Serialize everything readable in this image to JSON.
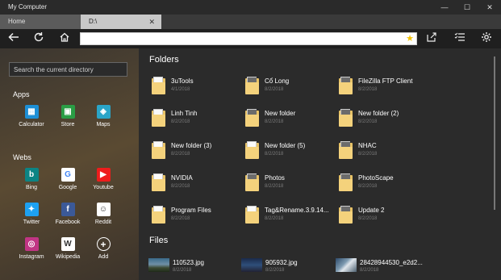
{
  "window": {
    "title": "My Computer",
    "minimize": "—",
    "maximize": "☐",
    "close": "✕"
  },
  "tabs": [
    {
      "label": "Home"
    },
    {
      "label": "D:\\",
      "close": "✕"
    }
  ],
  "toolbar": {
    "address_value": "",
    "icons": [
      "back-arrow-icon",
      "refresh-icon",
      "home-icon",
      "star-icon",
      "share-icon",
      "selection-icon",
      "gear-icon"
    ]
  },
  "sidebar": {
    "search_placeholder": "Search the current directory",
    "apps_heading": "Apps",
    "apps": [
      {
        "label": "Calculator",
        "icon": "calculator-icon",
        "color": "#1d8fd6",
        "glyph": "▦"
      },
      {
        "label": "Store",
        "icon": "store-icon",
        "color": "#2a9d45",
        "glyph": "▣"
      },
      {
        "label": "Maps",
        "icon": "maps-icon",
        "color": "#2aa5c8",
        "glyph": "◈"
      }
    ],
    "webs_heading": "Webs",
    "webs": [
      {
        "label": "Bing",
        "icon": "bing-icon",
        "color": "#0c8484",
        "glyph": "b"
      },
      {
        "label": "Google",
        "icon": "google-icon",
        "color": "#ffffff",
        "glyph": "G"
      },
      {
        "label": "Youtube",
        "icon": "youtube-icon",
        "color": "#ee1c1c",
        "glyph": "▶"
      },
      {
        "label": "Twitter",
        "icon": "twitter-icon",
        "color": "#1da1f2",
        "glyph": "✦"
      },
      {
        "label": "Facebook",
        "icon": "facebook-icon",
        "color": "#3b5998",
        "glyph": "f"
      },
      {
        "label": "Reddit",
        "icon": "reddit-icon",
        "color": "#ffffff",
        "glyph": "☺"
      },
      {
        "label": "Instagram",
        "icon": "instagram-icon",
        "color": "#c13584",
        "glyph": "◎"
      },
      {
        "label": "Wikipedia",
        "icon": "wikipedia-icon",
        "color": "#ffffff",
        "glyph": "W"
      },
      {
        "label": "Add",
        "icon": "add-icon",
        "color": "transparent",
        "glyph": "+"
      }
    ]
  },
  "main": {
    "folders_heading": "Folders",
    "files_heading": "Files",
    "folders": [
      {
        "name": "3uTools",
        "date": "4/1/2018"
      },
      {
        "name": "Cổ Long",
        "date": "8/2/2018"
      },
      {
        "name": "FileZilla FTP Client",
        "date": "8/2/2018"
      },
      {
        "name": "Linh Tinh",
        "date": "8/2/2018"
      },
      {
        "name": "New folder",
        "date": "8/2/2018"
      },
      {
        "name": "New folder (2)",
        "date": "8/2/2018"
      },
      {
        "name": "New folder (3)",
        "date": "8/2/2018"
      },
      {
        "name": "New folder (5)",
        "date": "8/2/2018"
      },
      {
        "name": "NHAC",
        "date": "8/2/2018"
      },
      {
        "name": "NVIDIA",
        "date": "8/2/2018"
      },
      {
        "name": "Photos",
        "date": "8/2/2018"
      },
      {
        "name": "PhotoScape",
        "date": "8/2/2018"
      },
      {
        "name": "Program Files",
        "date": "8/2/2018"
      },
      {
        "name": "Tag&Rename.3.9.14...",
        "date": "8/2/2018"
      },
      {
        "name": "Update 2",
        "date": "8/2/2018"
      }
    ],
    "files": [
      {
        "name": "110523.jpg",
        "date": "8/2/2018"
      },
      {
        "name": "905932.jpg",
        "date": "8/2/2018"
      },
      {
        "name": "28428944530_e2d2...",
        "date": "8/2/2018"
      }
    ]
  }
}
